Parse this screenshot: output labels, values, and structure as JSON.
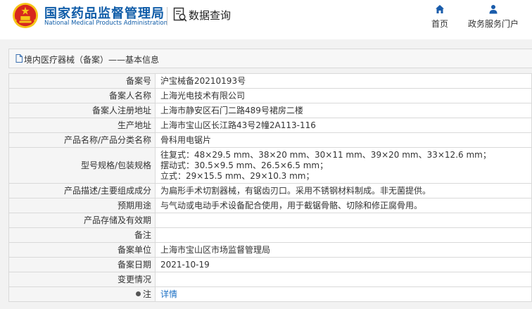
{
  "header": {
    "agency_cn": "国家药品监督管理局",
    "agency_en": "National Medical Products Administration",
    "query_title": "数据查询",
    "nav": [
      {
        "label": "首页",
        "icon": "home-icon"
      },
      {
        "label": "政务服务门户",
        "icon": "user-icon"
      }
    ]
  },
  "panel": {
    "title": "境内医疗器械（备案）——基本信息"
  },
  "rows": [
    {
      "key": "备案号",
      "value": "沪宝械备20210193号"
    },
    {
      "key": "备案人名称",
      "value": "上海光电技术有限公司"
    },
    {
      "key": "备案人注册地址",
      "value": "上海市静安区石门二路489号裙房二楼"
    },
    {
      "key": "生产地址",
      "value": "上海市宝山区长江路43号2幢2A113-116"
    },
    {
      "key": "产品名称/产品分类名称",
      "value": "骨科用电锯片"
    },
    {
      "key": "型号规格/包装规格",
      "value": "往复式：48×29.5 mm、38×20 mm、30×11 mm、39×20 mm、33×12.6 mm；\n摆动式：30.5×9.5 mm、26.5×6.5 mm；\n立式：29×15.5 mm、29×10.3 mm；"
    },
    {
      "key": "产品描述/主要组成成分",
      "value": "为扁形手术切割器械，有锯齿刃口。采用不锈钢材料制成。非无菌提供。"
    },
    {
      "key": "预期用途",
      "value": "与气动或电动手术设备配合使用，用于截锯骨骼、切除和修正腐骨用。"
    },
    {
      "key": "产品存储及有效期",
      "value": ""
    },
    {
      "key": "备注",
      "value": ""
    },
    {
      "key": "备案单位",
      "value": "上海市宝山区市场监督管理局"
    },
    {
      "key": "备案日期",
      "value": "2021-10-19"
    },
    {
      "key": "变更情况",
      "value": ""
    },
    {
      "key": "注",
      "value": "详情"
    }
  ],
  "colors": {
    "brand_blue": "#0f5ca8",
    "link_blue": "#1a6fc4",
    "emblem_red": "#d7261e",
    "emblem_gold": "#f5c518"
  }
}
